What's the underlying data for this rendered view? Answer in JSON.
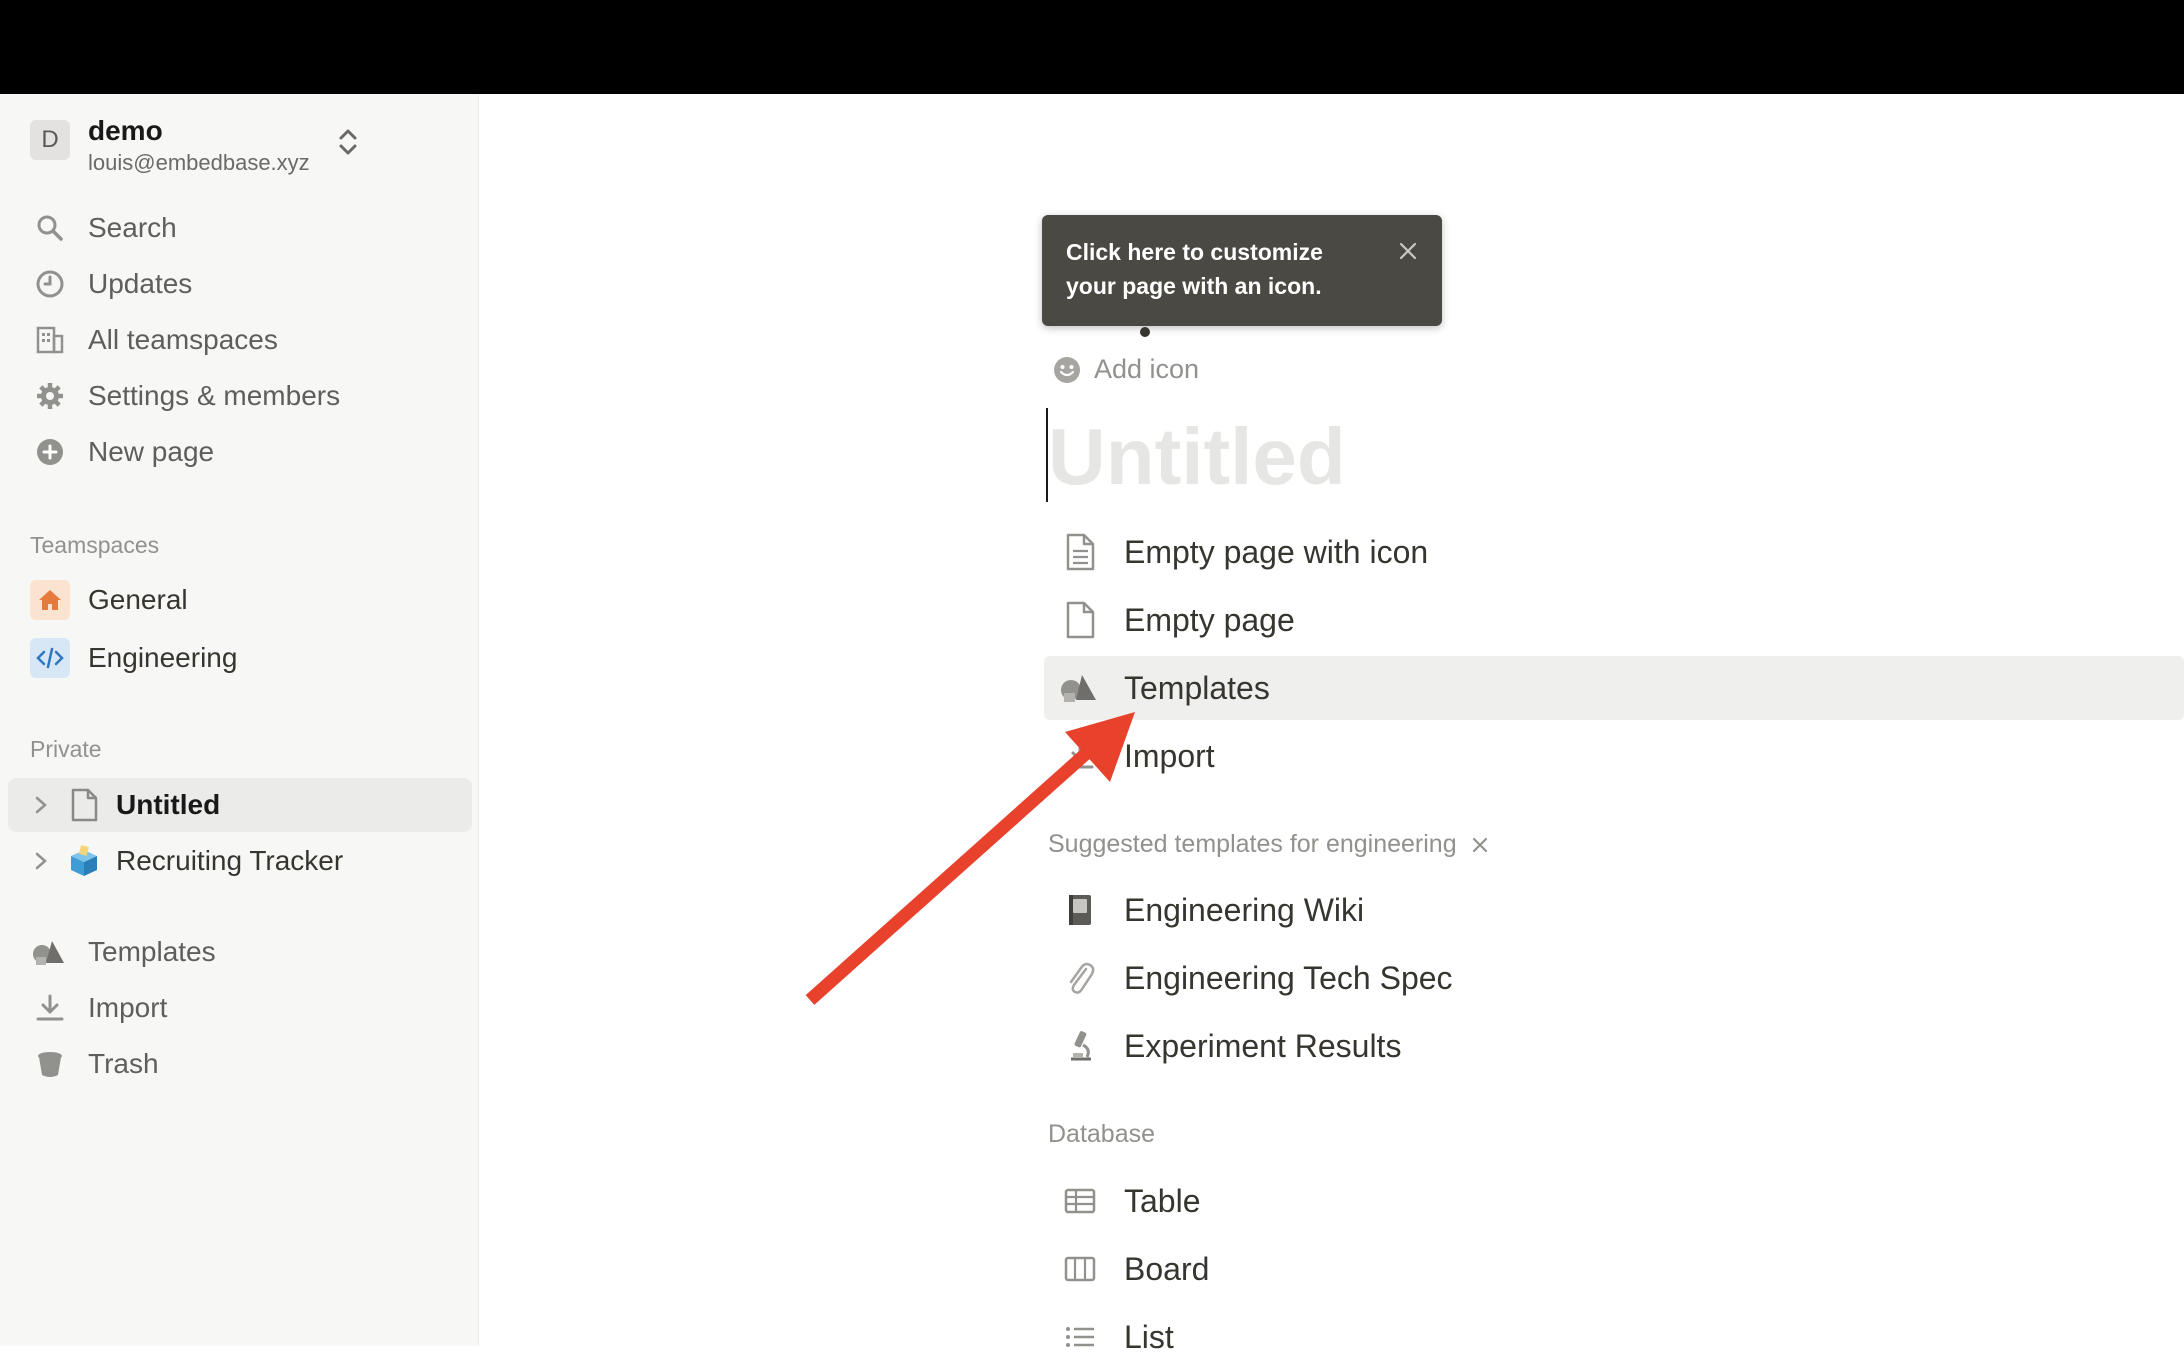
{
  "workspace": {
    "avatar_letter": "D",
    "name": "demo",
    "email": "louis@embedbase.xyz"
  },
  "sidebar": {
    "nav": [
      {
        "label": "Search",
        "icon": "search-icon"
      },
      {
        "label": "Updates",
        "icon": "clock-icon"
      },
      {
        "label": "All teamspaces",
        "icon": "building-icon"
      },
      {
        "label": "Settings & members",
        "icon": "gear-icon"
      },
      {
        "label": "New page",
        "icon": "plus-circle-icon"
      }
    ],
    "teamspaces_label": "Teamspaces",
    "teamspaces": [
      {
        "label": "General",
        "icon": "home-icon",
        "color": "#e57a3b"
      },
      {
        "label": "Engineering",
        "icon": "code-icon",
        "color": "#2f76c0"
      }
    ],
    "private_label": "Private",
    "private": [
      {
        "label": "Untitled",
        "icon": "page-icon",
        "active": true
      },
      {
        "label": "Recruiting Tracker",
        "icon": "ballot-box-icon",
        "active": false
      }
    ],
    "footer": [
      {
        "label": "Templates",
        "icon": "shapes-icon"
      },
      {
        "label": "Import",
        "icon": "download-icon"
      },
      {
        "label": "Trash",
        "icon": "trash-icon"
      }
    ]
  },
  "tooltip": {
    "text": "Click here to customize your page with an icon."
  },
  "page": {
    "add_icon_label": "Add icon",
    "title_placeholder": "Untitled",
    "options": [
      {
        "label": "Empty page with icon",
        "icon": "page-lines-icon"
      },
      {
        "label": "Empty page",
        "icon": "page-icon"
      },
      {
        "label": "Templates",
        "icon": "shapes-icon",
        "highlighted": true
      },
      {
        "label": "Import",
        "icon": "download-icon"
      }
    ],
    "suggested_label": "Suggested templates for engineering",
    "suggested": [
      {
        "label": "Engineering Wiki",
        "icon": "notebook-icon"
      },
      {
        "label": "Engineering Tech Spec",
        "icon": "paperclip-icon"
      },
      {
        "label": "Experiment Results",
        "icon": "microscope-icon"
      }
    ],
    "database_label": "Database",
    "database": [
      {
        "label": "Table",
        "icon": "table-icon"
      },
      {
        "label": "Board",
        "icon": "board-icon"
      },
      {
        "label": "List",
        "icon": "list-icon"
      }
    ]
  },
  "colors": {
    "annotation_arrow": "#e8412c",
    "tooltip_bg": "#4b4943",
    "sidebar_bg": "#f7f7f5"
  }
}
